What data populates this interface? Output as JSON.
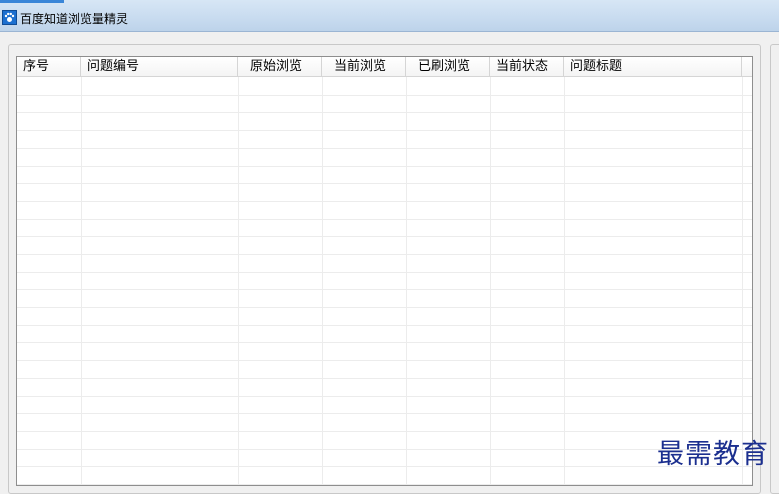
{
  "window": {
    "title": "百度知道浏览量精灵",
    "icon": "paw-icon"
  },
  "table": {
    "columns": [
      "序号",
      "问题编号",
      "原始浏览",
      "当前浏览",
      "已刷浏览",
      "当前状态",
      "问题标题"
    ],
    "rows": []
  },
  "watermark": "最需教育",
  "colors": {
    "title_accent": "#3a86d8",
    "watermark": "#1b2f8f"
  }
}
